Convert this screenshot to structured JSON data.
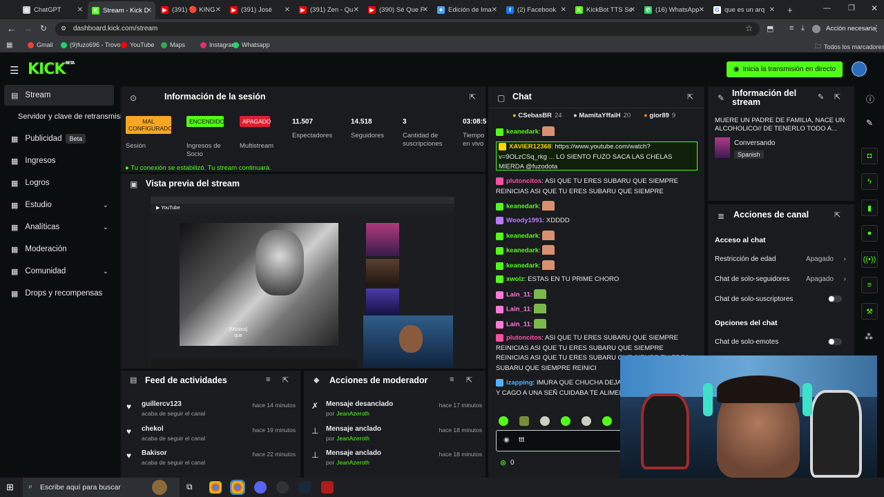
{
  "browser": {
    "tabs": [
      {
        "label": "ChatGPT",
        "color": "#c8c8c8",
        "glyph": "◎"
      },
      {
        "label": "Stream - Kick D",
        "color": "#53fc18",
        "glyph": "K",
        "active": true
      },
      {
        "label": "(391) 🔴 KING",
        "color": "#ff0000",
        "glyph": "▶"
      },
      {
        "label": "(391) José",
        "color": "#ff0000",
        "glyph": "▶"
      },
      {
        "label": "(391) Zen - Qu",
        "color": "#ff0000",
        "glyph": "▶"
      },
      {
        "label": "(390) Sé Que F",
        "color": "#ff0000",
        "glyph": "▶"
      },
      {
        "label": "Edición de Ima",
        "color": "#4aa0ff",
        "glyph": "✦"
      },
      {
        "label": "(2) Facebook",
        "color": "#1877f2",
        "glyph": "f"
      },
      {
        "label": "KickBot TTS Se",
        "color": "#53fc18",
        "glyph": "K"
      },
      {
        "label": "(16) WhatsApp",
        "color": "#25d366",
        "glyph": "✆"
      },
      {
        "label": "que es un arq",
        "color": "#ffffff",
        "glyph": "G"
      }
    ],
    "url": "dashboard.kick.com/stream",
    "profile_button": "Acción necesaria",
    "bookmarks": [
      {
        "label": "Gmail",
        "color": "#ea4335"
      },
      {
        "label": "(9)fuzo696 - Trovo",
        "color": "#19d66b"
      },
      {
        "label": "YouTube",
        "color": "#ff0000"
      },
      {
        "label": "Maps",
        "color": "#34a853"
      },
      {
        "label": "Instagram",
        "color": "#e1306c"
      },
      {
        "label": "Whatsapp",
        "color": "#25d366"
      }
    ],
    "all_bookmarks": "Todos los marcadores"
  },
  "kick": {
    "logo": "KICK",
    "logo_sup": "BETA",
    "go_live": "Inicia la transmisión en directo",
    "accent": "#53fc18"
  },
  "sidebar": {
    "items": [
      {
        "label": "Stream",
        "icon": "stream-icon",
        "active": true
      },
      {
        "label": "Servidor y clave de retransmisión",
        "icon": "",
        "sub": true
      },
      {
        "label": "Publicidad",
        "icon": "ads-icon",
        "badge": "Beta"
      },
      {
        "label": "Ingresos",
        "icon": "income-icon"
      },
      {
        "label": "Logros",
        "icon": "achievements-icon"
      },
      {
        "label": "Estudio",
        "icon": "studio-icon",
        "chevron": true
      },
      {
        "label": "Analíticas",
        "icon": "analytics-icon",
        "chevron": true
      },
      {
        "label": "Moderación",
        "icon": "moderation-icon"
      },
      {
        "label": "Comunidad",
        "icon": "community-icon",
        "chevron": true
      },
      {
        "label": "Drops y recompensas",
        "icon": "drops-icon"
      }
    ]
  },
  "session": {
    "title": "Información de la sesión",
    "stats": [
      {
        "value": "MAL CONFIGURADO",
        "label": "Sesión",
        "badge_color": "#f5a623",
        "text_color": "#1a1a1a"
      },
      {
        "value": "ENCENDIDO",
        "label": "Ingresos de Socio",
        "badge_color": "#53fc18",
        "text_color": "#0b0e0f"
      },
      {
        "value": "APAGADO",
        "label": "Multistream",
        "badge_color": "#e0202f",
        "text_color": "#ffffff"
      },
      {
        "value": "11.507",
        "label": "Espectadores"
      },
      {
        "value": "14.518",
        "label": "Seguidores"
      },
      {
        "value": "3",
        "label": "Cantidad de suscripciones"
      },
      {
        "value": "03:08:5",
        "label": "Tiempo en vivo"
      }
    ],
    "notice": "Tu conexión se estabilizó. Tu stream continuará."
  },
  "preview": {
    "title": "Vista previa del stream",
    "caption_line1": "[Música]",
    "caption_line2": "que"
  },
  "activity": {
    "title": "Feed de actividades",
    "rows": [
      {
        "user": "guillercv123",
        "action": "acaba de seguir el canal",
        "time": "hace 14 minutos"
      },
      {
        "user": "chekol",
        "action": "acaba de seguir el canal",
        "time": "hace 19 minutos"
      },
      {
        "user": "Bakisor",
        "action": "acaba de seguir el canal",
        "time": "hace 22 minutos"
      }
    ]
  },
  "modactions": {
    "title": "Acciones de moderador",
    "rows": [
      {
        "action": "Mensaje desanclado",
        "by": "por",
        "mod": "JeanAzeroth",
        "time": "hace 17 minutos"
      },
      {
        "action": "Mensaje anclado",
        "by": "por",
        "mod": "JeanAzeroth",
        "time": "hace 18 minutos"
      },
      {
        "action": "Mensaje anclado",
        "by": "por",
        "mod": "JeanAzeroth",
        "time": "hace 18 minutos"
      }
    ]
  },
  "chat": {
    "title": "Chat",
    "top_gifters": [
      {
        "name": "CSebasBR",
        "count": "24"
      },
      {
        "name": "MamitaYffaiH",
        "count": "20"
      },
      {
        "name": "gior89",
        "count": "9"
      }
    ],
    "messages": [
      {
        "user": "keanedark",
        "color": "#53fc18",
        "text": ""
      },
      {
        "user": "XAVIER12368",
        "color": "#ffd700",
        "text": "https://www.youtube.com/watch?v=9OLzCSq_rkg ... LO SIENTO FUZO SACA LAS CHELAS MIERDA @fuzodota",
        "highlight": true
      },
      {
        "user": "plutoncitos",
        "color": "#ff4fa3",
        "text": "ASI QUE TU ERES SUBARU QUE SIEMPRE REINICIAS ASI QUE TU ERES SUBARU QUE SIEMPRE REINICIAS"
      },
      {
        "user": "keanedark",
        "color": "#53fc18",
        "text": ""
      },
      {
        "user": "Woody1991",
        "color": "#b77bff",
        "text": "XDDDD"
      },
      {
        "user": "keanedark",
        "color": "#53fc18",
        "text": ""
      },
      {
        "user": "keanedark",
        "color": "#53fc18",
        "text": ""
      },
      {
        "user": "keanedark",
        "color": "#53fc18",
        "text": ""
      },
      {
        "user": "xwolz",
        "color": "#53fc18",
        "text": "ESTAS EN TU PRIME CHORO"
      },
      {
        "user": "Lain_11",
        "color": "#ff7ad9",
        "text": ""
      },
      {
        "user": "Lain_11",
        "color": "#ff7ad9",
        "text": ""
      },
      {
        "user": "Lain_11",
        "color": "#ff7ad9",
        "text": ""
      },
      {
        "user": "plutoncitos",
        "color": "#ff4fa3",
        "text": "ASI QUE TU ERES SUBARU QUE SIEMPRE REINICIAS ASI QUE TU ERES SUBARU QUE SIEMPRE REINICIAS ASI QUE TU ERES SUBARU QUE SIEMPR TU ERES SUBARU QUE SIEMPRE REINICI"
      },
      {
        "user": "izapping",
        "color": "#4fb4ff",
        "text": "IMURA QUE CHUCHA DEJAS C SI ARRUINO TODO Y CAGO A UNA SEÑ CUIDABA TE ALIMENTABA Y TE DABA F"
      }
    ],
    "input_value": "ttt",
    "points": "0"
  },
  "streaminfo": {
    "title": "Información del stream",
    "stream_title": "MUERE UN PADRE DE FAMILIA, NACE UN ALCOHOLICO// DE TENERLO TODO A...",
    "category": "Conversando",
    "language": "Spanish"
  },
  "channel": {
    "title": "Acciones de canal",
    "chat_access": "Acceso al chat",
    "settings": [
      {
        "label": "Restricción de edad",
        "value": "Apagado",
        "kind": "select"
      },
      {
        "label": "Chat de solo-seguidores",
        "value": "Apagado",
        "kind": "select"
      },
      {
        "label": "Chat de solo-suscriptores",
        "kind": "toggle",
        "on": false
      }
    ],
    "chat_options": "Opciones del chat",
    "settings2": [
      {
        "label": "Chat de solo-emotes",
        "kind": "toggle",
        "on": false
      }
    ]
  },
  "taskbar": {
    "search_placeholder": "Escribe aquí para buscar"
  }
}
